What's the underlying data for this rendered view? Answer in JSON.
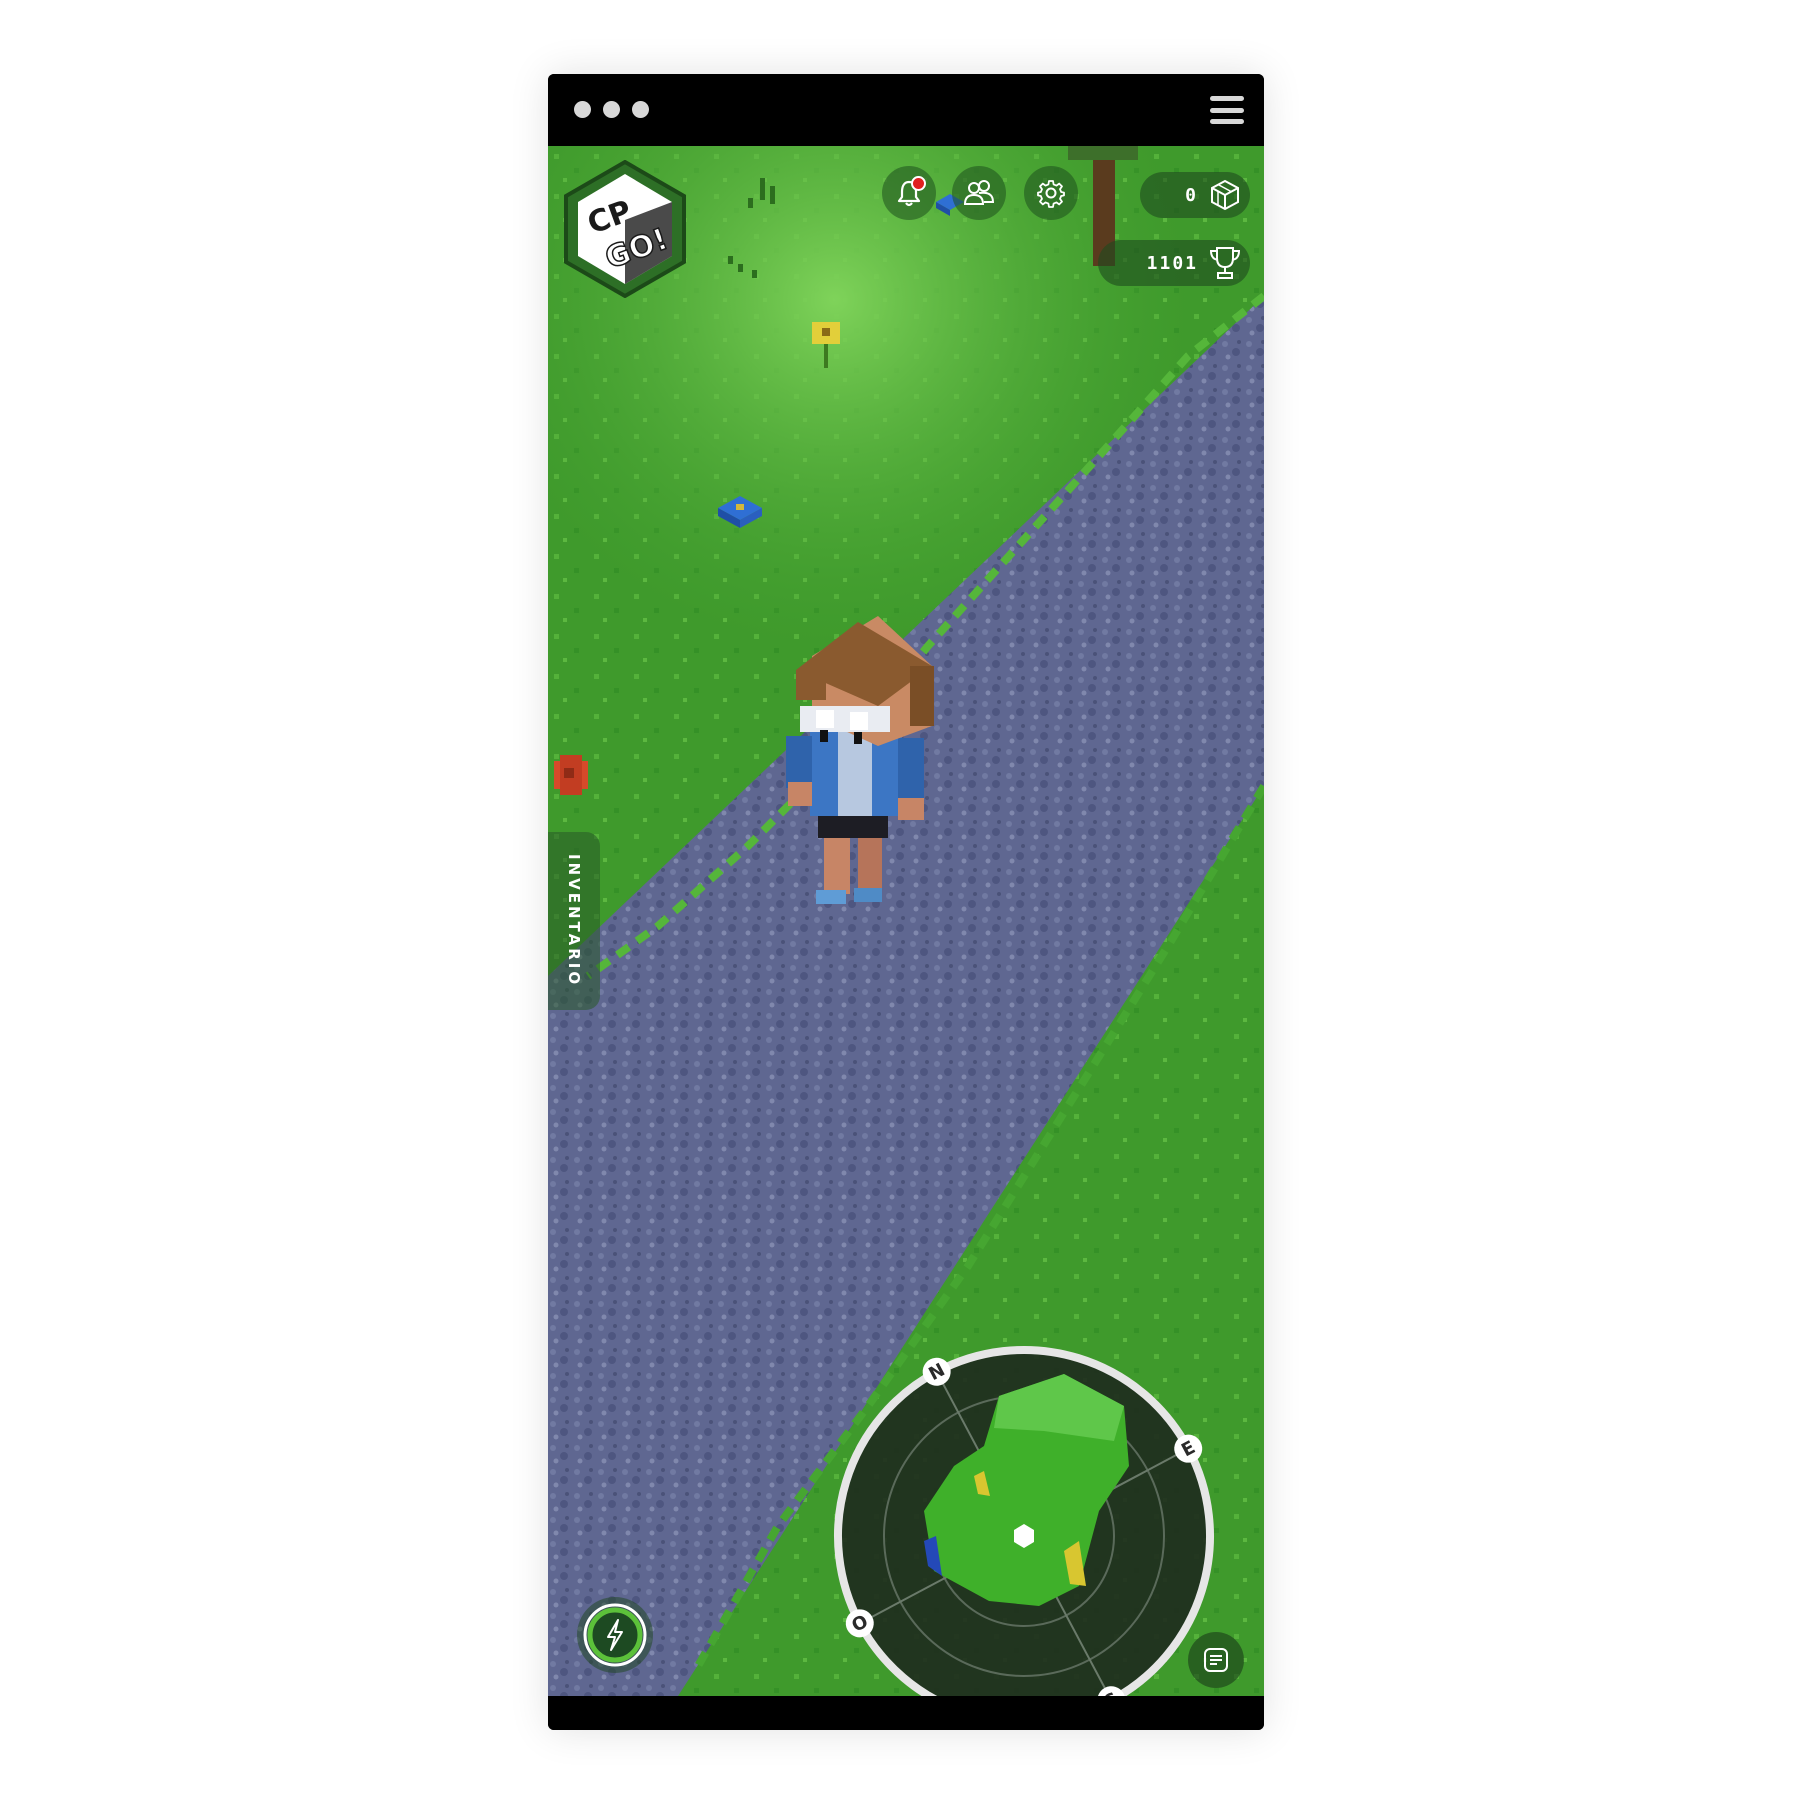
{
  "window": {
    "dots": [
      "dot",
      "dot",
      "dot"
    ],
    "menu_icon": "hamburger-icon"
  },
  "hud": {
    "logo_text": "CP GO!",
    "notification_icon": "bell-icon",
    "friends_icon": "people-icon",
    "settings_icon": "gear-icon",
    "cubes_count": "0",
    "cubes_icon": "cube-icon",
    "trophies_count": "1101",
    "trophy_icon": "trophy-icon"
  },
  "inventory_tab": {
    "label": "INVENTARIO"
  },
  "compass": {
    "north": "N",
    "east": "E",
    "south": "S",
    "west": "O"
  },
  "power_button": {
    "icon": "lightning-icon"
  },
  "notes_button": {
    "icon": "notes-icon"
  },
  "colors": {
    "grass": "#3f9a2c",
    "path": "#5d6590",
    "hud_dark": "#1e4b1e",
    "accent_green": "#5cc13a",
    "notification_dot": "#e02020"
  }
}
